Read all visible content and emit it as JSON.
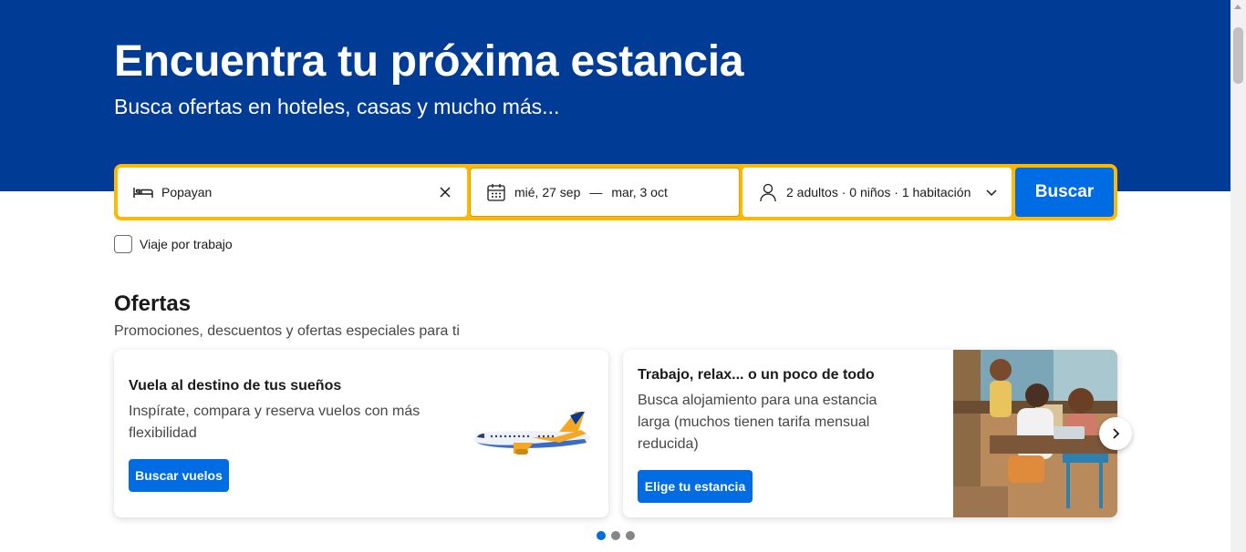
{
  "hero": {
    "title": "Encuentra tu próxima estancia",
    "subtitle": "Busca ofertas en hoteles, casas y mucho más..."
  },
  "search": {
    "destination_value": "Popayan",
    "destination_icon": "bed-icon",
    "checkin": "mié, 27 sep",
    "dash": "—",
    "checkout": "mar, 3 oct",
    "occupancy": "2 adultos · 0 niños · 1 habitación",
    "button_label": "Buscar"
  },
  "business_trip": {
    "label": "Viaje por trabajo",
    "checked": false
  },
  "offers": {
    "title": "Ofertas",
    "subtitle": "Promociones, descuentos y ofertas especiales para ti",
    "cards": [
      {
        "title": "Vuela al destino de tus sueños",
        "description": "Inspírate, compara y reserva vuelos con más flexibilidad",
        "button": "Buscar vuelos"
      },
      {
        "title": "Trabajo, relax... o un poco de todo",
        "description": "Busca alojamiento para una estancia larga (muchos tienen tarifa mensual reducida)",
        "button": "Elige tu estancia"
      }
    ],
    "carousel_page": 1,
    "carousel_pages": 3
  },
  "colors": {
    "brand_blue": "#003b95",
    "accent_yellow": "#ffb700",
    "action_blue": "#006ce4"
  }
}
